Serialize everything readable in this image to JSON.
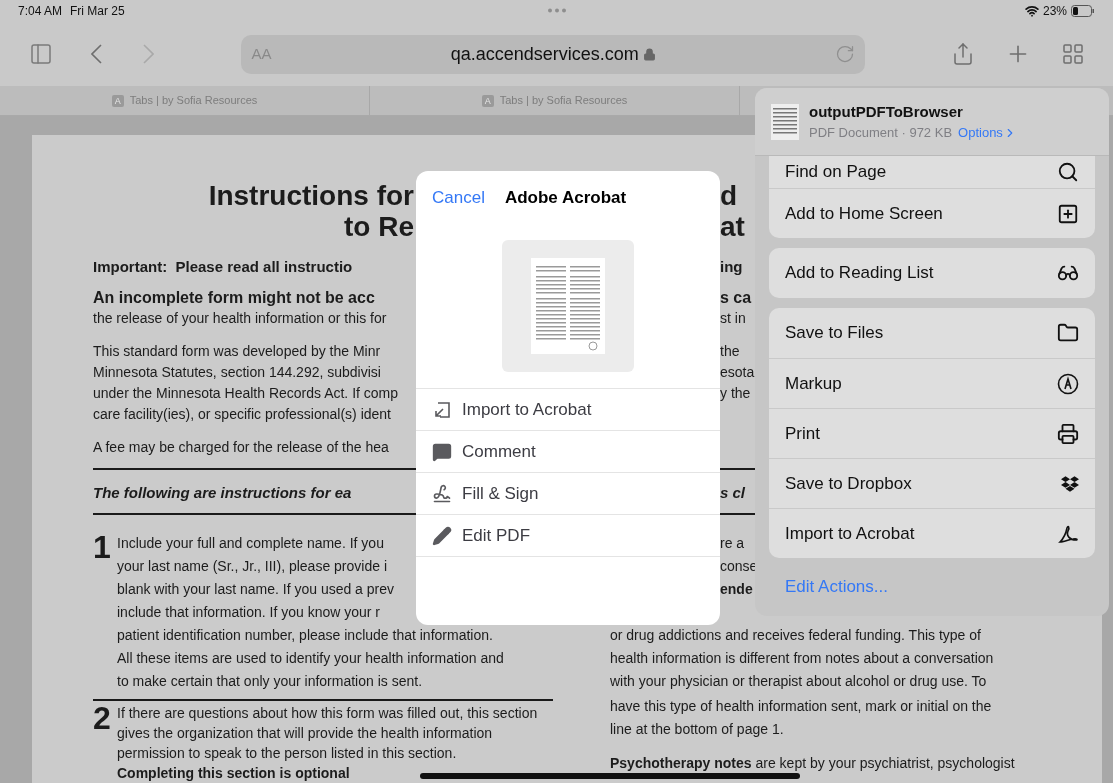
{
  "status_bar": {
    "time": "7:04 AM",
    "date": "Fri Mar 25",
    "battery": "23%"
  },
  "toolbar": {
    "back_disabled": false,
    "forward_disabled": true,
    "reader_button": "AA",
    "url": "qa.accendservices.com"
  },
  "tabs": [
    {
      "favicon": "A",
      "label": "Tabs | by Sofia Resources",
      "selected": false
    },
    {
      "favicon": "A",
      "label": "Tabs | by Sofia Resources",
      "selected": false
    }
  ],
  "document": {
    "rows": [
      {
        "kind": "title",
        "left": "Instructions for",
        "right": "d"
      },
      {
        "kind": "title",
        "left": "to Re",
        "right": "at"
      },
      {
        "kind": "important",
        "left": "Important:  Please read all instructio",
        "right": "ing"
      },
      {
        "kind": "lead",
        "left": "An incomplete form might not be acc",
        "right": "s ca"
      },
      {
        "kind": "body",
        "left": "the release of your health information or this for",
        "right": "st in"
      },
      {
        "kind": "paragraph",
        "left": "This standard form was developed by the Minr",
        "right": "the"
      },
      {
        "kind": "body",
        "left": "Minnesota Statutes, section 144.292, subdivisi",
        "right": "esota"
      },
      {
        "kind": "body",
        "left": "under the Minnesota Health Records Act. If comp",
        "right": "y the"
      },
      {
        "kind": "body",
        "left": "care facility(ies), or specific professional(s) ident"
      },
      {
        "kind": "paragraph",
        "left": "A fee may be charged for the release of the hea"
      },
      {
        "kind": "rule"
      },
      {
        "kind": "heading",
        "left": "The following are instructions for ea",
        "right": "s cl"
      },
      {
        "kind": "rule"
      }
    ],
    "item_1": {
      "number": "1",
      "rows": [
        {
          "left": "Include your full and complete name. If you",
          "right": "re a",
          "right_start_hidden": true,
          "right_bold": false
        },
        {
          "left": "your last name (Sr., Jr., III), please provide i",
          "right": "conse",
          "right_start_hidden": true,
          "right_bold": false
        },
        {
          "left": "blank with your last name. If you used a prev",
          "right": "ende",
          "right_start_hidden": true,
          "right_bold": true
        },
        {
          "left": "include that information. If you know your r"
        },
        {
          "left": "patient identification number, please include that information.",
          "right": "or drug addictions and receives federal funding. This type of",
          "right_start_hidden": false,
          "right_bold": false
        },
        {
          "left": "All these items are used to identify your health information and",
          "right": "health information is different from notes about a conversation",
          "right_start_hidden": false,
          "right_bold": false
        },
        {
          "left": "to make certain that only your information is sent.",
          "right": "with your physician or therapist about alcohol or drug use. To",
          "right_start_hidden": false,
          "right_bold": false
        }
      ]
    },
    "item_2": {
      "number": "2",
      "lines": [
        "If there are questions about how this form was filled out, this section",
        "gives the organization that will provide the health information",
        "permission to speak to the person listed in this section."
      ],
      "bold_line": "Completing this section is optional"
    },
    "right_lower": {
      "lines": [
        "have this type of health information sent, mark or initial on the",
        "line at the bottom of page 1."
      ],
      "paragraph": "**Psychotherapy notes** are kept by your psychiatrist, psychologist"
    }
  },
  "dialog": {
    "cancel": "Cancel",
    "title": "Adobe Acrobat",
    "actions": [
      {
        "label": "Import to Acrobat"
      },
      {
        "label": "Comment"
      },
      {
        "label": "Fill & Sign"
      },
      {
        "label": "Edit PDF"
      }
    ]
  },
  "share_sheet": {
    "file_name": "outputPDFToBrowser",
    "file_info": "PDF Document · 972 KB",
    "options": "Options",
    "groups": [
      {
        "items": [
          {
            "label": "Find on Page"
          },
          {
            "label": "Add to Home Screen"
          }
        ]
      },
      {
        "items": [
          {
            "label": "Add to Reading List"
          }
        ]
      },
      {
        "items": [
          {
            "label": "Save to Files"
          },
          {
            "label": "Markup"
          },
          {
            "label": "Print"
          },
          {
            "label": "Save to Dropbox"
          },
          {
            "label": "Import to Acrobat"
          }
        ]
      }
    ],
    "edit_actions": "Edit Actions..."
  }
}
